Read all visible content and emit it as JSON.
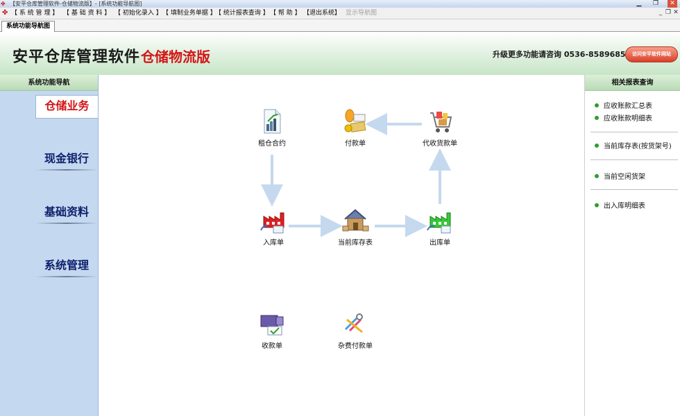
{
  "window": {
    "title": "【安平仓库管理软件-仓储物流版】- [系统功能导航图]"
  },
  "menu": {
    "items": [
      "【 系 统 管 理 】",
      "【 基 础 资 料 】",
      "【 初始化录入 】",
      "【 填制业务单据 】",
      "【 统计报表查询 】",
      "【 帮 助 】",
      "【退出系统】"
    ],
    "disabled_item": "显示导航图"
  },
  "tabs": [
    "系统功能导航图"
  ],
  "header": {
    "app_name": "安平仓库管理软件",
    "edition": "仓储物流版",
    "contact": "升级更多功能请咨询 0536-8589685",
    "visit_button": "访问安平软件网站"
  },
  "left_nav": {
    "title": "系统功能导航",
    "items": [
      "仓储业务",
      "现金银行",
      "基础资料",
      "系统管理"
    ],
    "active_index": 0
  },
  "workflow": {
    "nodes": {
      "lease_contract": "租仓合约",
      "payment": "付款单",
      "collection_on_behalf": "代收货款单",
      "stock_in": "入库单",
      "current_stock": "当前库存表",
      "stock_out": "出库单",
      "receipt": "收款单",
      "misc_payment": "杂费付款单"
    }
  },
  "right_panel": {
    "title": "相关报表查询",
    "groups": [
      [
        "应收账款汇总表",
        "应收账款明细表"
      ],
      [
        "当前库存表(按货架号)"
      ],
      [
        "当前空闲货架"
      ],
      [
        "出入库明细表"
      ]
    ]
  },
  "colors": {
    "accent_red": "#d41515",
    "nav_text": "#0d1f6b",
    "nav_bg": "#c4d8ef",
    "header_green": "#c7e5c7",
    "arrow": "#c5d9ee",
    "report_dot": "#2e9e2e"
  }
}
